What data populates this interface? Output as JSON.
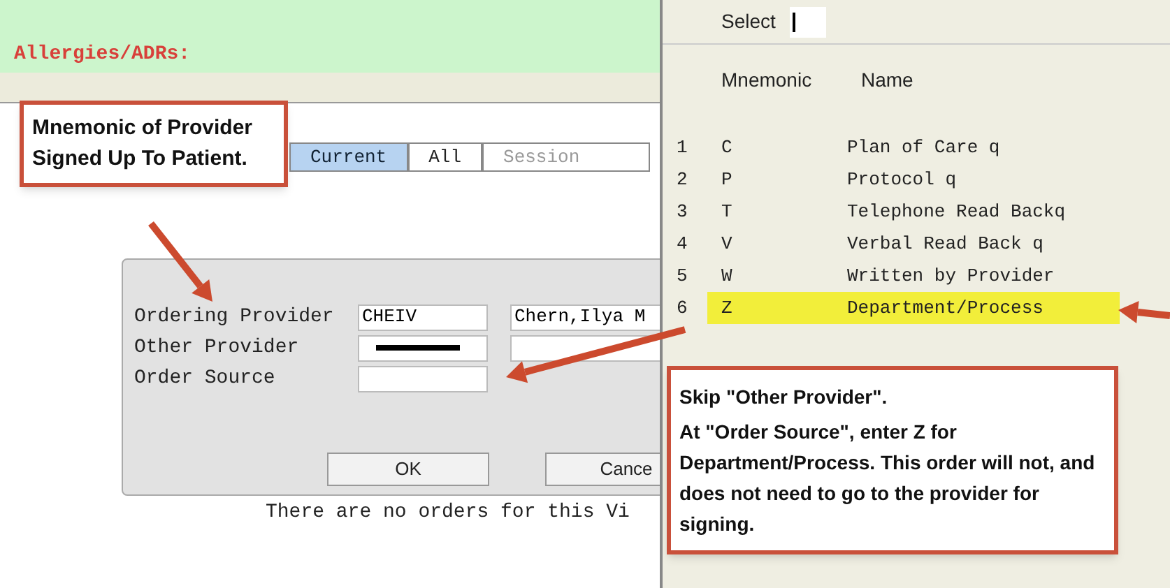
{
  "allergies_label": "Allergies/ADRs:",
  "tabs": [
    {
      "label": "Current",
      "selected": true
    },
    {
      "label": "All",
      "selected": false
    },
    {
      "label": "Session",
      "selected": false
    }
  ],
  "dialog": {
    "fields": [
      {
        "label": "Ordering Provider",
        "value": "CHEIV",
        "name_value": "Chern,Ilya M",
        "redacted": false
      },
      {
        "label": "Other Provider",
        "redacted": true
      },
      {
        "label": "Order Source",
        "redacted": false
      }
    ],
    "buttons": [
      "OK",
      "Cance"
    ]
  },
  "message": "There are no orders for this Vi",
  "lookup": {
    "select_label": "Select",
    "columns": [
      "Mnemonic",
      "Name"
    ],
    "rows": [
      {
        "number": "1",
        "mnemonic": "C",
        "name": "Plan of Care q",
        "selected": false
      },
      {
        "number": "2",
        "mnemonic": "P",
        "name": "Protocol q",
        "selected": false
      },
      {
        "number": "3",
        "mnemonic": "T",
        "name": "Telephone Read Backq",
        "selected": false
      },
      {
        "number": "4",
        "mnemonic": "V",
        "name": "Verbal Read Back q",
        "selected": false
      },
      {
        "number": "5",
        "mnemonic": "W",
        "name": "Written by Provider",
        "selected": false
      },
      {
        "number": "6",
        "mnemonic": "Z",
        "name": "Department/Process",
        "selected": true
      }
    ]
  },
  "callouts": [
    {
      "paragraphs": [
        "Mnemonic of Provider Signed Up To Patient."
      ]
    },
    {
      "paragraphs": [
        "Skip \"Other Provider\".",
        "At \"Order Source\", enter Z for Department/Process.  This order will not, and does not need to go to the provider for signing."
      ]
    }
  ]
}
